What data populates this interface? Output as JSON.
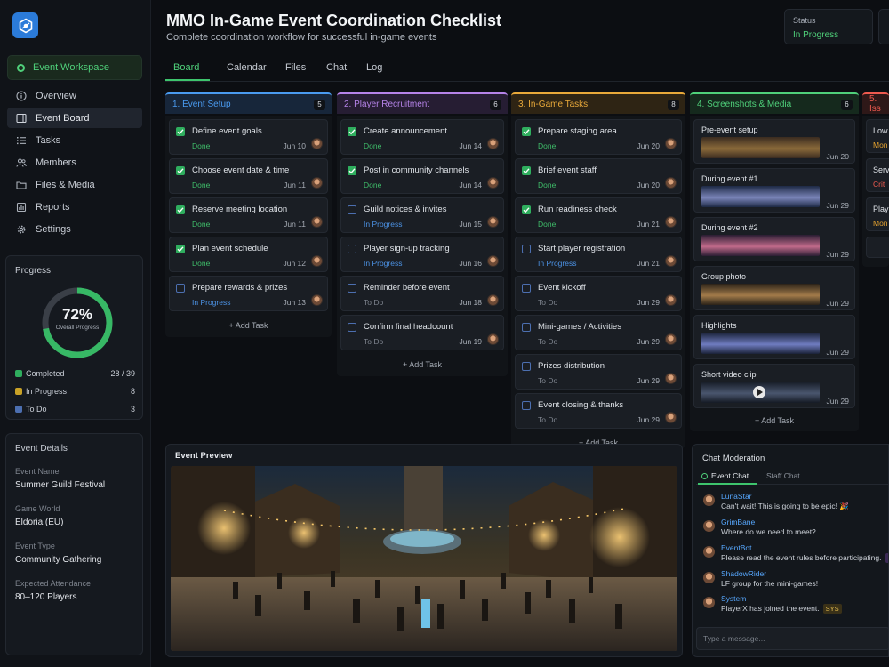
{
  "header": {
    "title": "MMO In-Game Event Coordination Checklist",
    "subtitle": "Complete coordination workflow for successful in-game events",
    "status_label": "Status",
    "status_value": "In Progress"
  },
  "sidebar": {
    "workspace": "Event Workspace",
    "items": [
      {
        "label": "Overview",
        "icon": "info-icon"
      },
      {
        "label": "Event Board",
        "icon": "board-icon",
        "active": true
      },
      {
        "label": "Tasks",
        "icon": "list-icon"
      },
      {
        "label": "Members",
        "icon": "users-icon"
      },
      {
        "label": "Files & Media",
        "icon": "folder-icon"
      },
      {
        "label": "Reports",
        "icon": "chart-icon"
      },
      {
        "label": "Settings",
        "icon": "gear-icon"
      }
    ]
  },
  "progress": {
    "title": "Progress",
    "percent_text": "72%",
    "percent_value": 0.72,
    "ring_label": "Overall Progress",
    "legend": [
      {
        "label": "Completed",
        "value": "28 / 39",
        "color": "#2fae5e"
      },
      {
        "label": "In Progress",
        "value": "8",
        "color": "#c9a227"
      },
      {
        "label": "To Do",
        "value": "3",
        "color": "#4c6fb0"
      }
    ]
  },
  "details": {
    "title": "Event Details",
    "fields": [
      {
        "label": "Event Name",
        "value": "Summer Guild Festival"
      },
      {
        "label": "Game World",
        "value": "Eldoria (EU)"
      },
      {
        "label": "Event Type",
        "value": "Community Gathering"
      },
      {
        "label": "Expected Attendance",
        "value": "80–120 Players"
      }
    ]
  },
  "tabs": [
    "Board",
    "Calendar",
    "Files",
    "Chat",
    "Log"
  ],
  "board": {
    "add_task": "+ Add Task",
    "columns": [
      {
        "title": "1. Event Setup",
        "count": "5",
        "color": "#4a9bf0",
        "bg": "#17263a",
        "tasks": [
          {
            "name": "Define event goals",
            "status": "Done",
            "date": "Jun 10"
          },
          {
            "name": "Choose event date & time",
            "status": "Done",
            "date": "Jun 11"
          },
          {
            "name": "Reserve meeting location",
            "status": "Done",
            "date": "Jun 11"
          },
          {
            "name": "Plan event schedule",
            "status": "Done",
            "date": "Jun 12"
          },
          {
            "name": "Prepare rewards & prizes",
            "status": "In Progress",
            "date": "Jun 13"
          }
        ]
      },
      {
        "title": "2. Player Recruitment",
        "count": "6",
        "color": "#b583e8",
        "bg": "#261d33",
        "tasks": [
          {
            "name": "Create announcement",
            "status": "Done",
            "date": "Jun 14"
          },
          {
            "name": "Post in community channels",
            "status": "Done",
            "date": "Jun 14"
          },
          {
            "name": "Guild notices & invites",
            "status": "In Progress",
            "date": "Jun 15"
          },
          {
            "name": "Player sign-up tracking",
            "status": "In Progress",
            "date": "Jun 16"
          },
          {
            "name": "Reminder before event",
            "status": "To Do",
            "date": "Jun 18"
          },
          {
            "name": "Confirm final headcount",
            "status": "To Do",
            "date": "Jun 19"
          }
        ]
      },
      {
        "title": "3. In-Game Tasks",
        "count": "8",
        "color": "#e9a93a",
        "bg": "#2e2414",
        "tasks": [
          {
            "name": "Prepare staging area",
            "status": "Done",
            "date": "Jun 20"
          },
          {
            "name": "Brief event staff",
            "status": "Done",
            "date": "Jun 20"
          },
          {
            "name": "Run readiness check",
            "status": "Done",
            "date": "Jun 21"
          },
          {
            "name": "Start player registration",
            "status": "In Progress",
            "date": "Jun 21"
          },
          {
            "name": "Event kickoff",
            "status": "To Do",
            "date": "Jun 29"
          },
          {
            "name": "Mini-games / Activities",
            "status": "To Do",
            "date": "Jun 29"
          },
          {
            "name": "Prizes distribution",
            "status": "To Do",
            "date": "Jun 29"
          },
          {
            "name": "Event closing & thanks",
            "status": "To Do",
            "date": "Jun 29"
          }
        ]
      },
      {
        "title": "4. Screenshots & Media",
        "count": "6",
        "color": "#4fd07a",
        "bg": "#15291d",
        "media": [
          {
            "name": "Pre-event setup",
            "date": "Jun 20",
            "kind": "image"
          },
          {
            "name": "During event #1",
            "date": "Jun 29",
            "kind": "image"
          },
          {
            "name": "During event #2",
            "date": "Jun 29",
            "kind": "image"
          },
          {
            "name": "Group photo",
            "date": "Jun 29",
            "kind": "image"
          },
          {
            "name": "Highlights",
            "date": "Jun 29",
            "kind": "image"
          },
          {
            "name": "Short video clip",
            "date": "Jun 29",
            "kind": "video"
          }
        ]
      },
      {
        "title": "5. Iss",
        "color": "#ef5a4f",
        "bg": "#2e1818",
        "issues": [
          {
            "name": "Low",
            "status": "Mon",
            "color": "#e3a12f"
          },
          {
            "name": "Serv",
            "status": "Crit",
            "color": "#ef5a4f"
          },
          {
            "name": "Play",
            "status": "Mon",
            "color": "#e3a12f"
          }
        ]
      }
    ]
  },
  "preview": {
    "title": "Event Preview"
  },
  "chat": {
    "title": "Chat Moderation",
    "tabs": [
      "Event Chat",
      "Staff Chat"
    ],
    "messages": [
      {
        "user": "LunaStar",
        "text": "Can't wait! This is going to be epic! 🎉",
        "badge": ""
      },
      {
        "user": "GrimBane",
        "text": "Where do we need to meet?",
        "badge": ""
      },
      {
        "user": "EventBot",
        "text": "Please read the event rules before participating.",
        "badge": "BOT"
      },
      {
        "user": "ShadowRider",
        "text": "LF group for the mini-games!",
        "badge": ""
      },
      {
        "user": "System",
        "text": "PlayerX has joined the event.",
        "badge": "SYS"
      }
    ],
    "placeholder": "Type a message..."
  }
}
